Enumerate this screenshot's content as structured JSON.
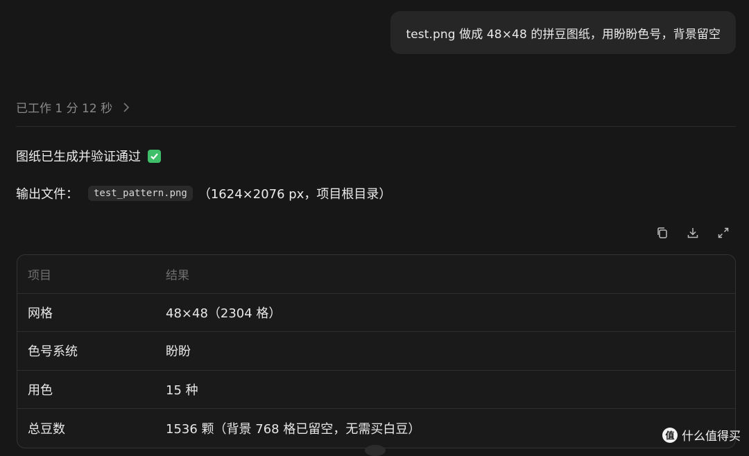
{
  "user_message": {
    "text": "test.png  做成 48×48 的拼豆图纸，用盼盼色号，背景留空"
  },
  "work_status": {
    "label": "已工作 1 分 12 秒",
    "icon": "chevron-right-icon"
  },
  "result": {
    "status_text": "图纸已生成并验证通过",
    "status_icon": "check-icon",
    "status_color": "#3fbf6a",
    "output_label": "输出文件：",
    "output_file": "test_pattern.png",
    "output_note": "（1624×2076 px，项目根目录）"
  },
  "toolbar": {
    "icons": [
      "copy-icon",
      "download-icon",
      "expand-icon"
    ]
  },
  "table": {
    "headers": [
      "项目",
      "结果"
    ],
    "rows": [
      [
        "网格",
        "48×48（2304 格）"
      ],
      [
        "色号系统",
        "盼盼"
      ],
      [
        "用色",
        "15 种"
      ],
      [
        "总豆数",
        "1536 颗（背景 768 格已留空，无需买白豆）"
      ]
    ]
  },
  "watermark": {
    "text": "什么值得买",
    "logo": "值"
  }
}
